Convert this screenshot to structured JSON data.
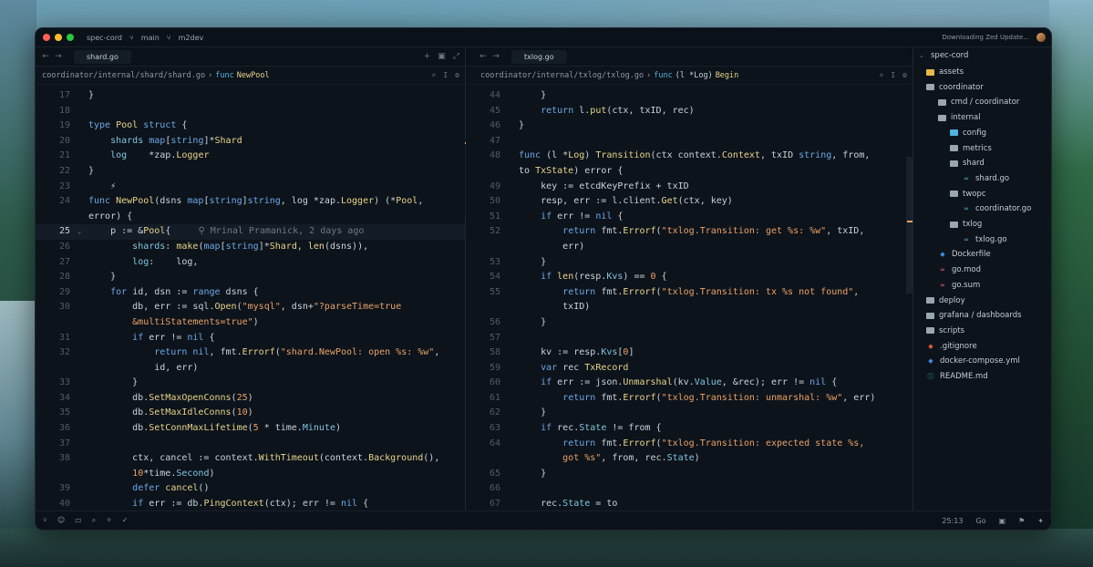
{
  "titlebar": {
    "project": "spec-cord",
    "branch_icon": "git-branch-icon",
    "branch": "main",
    "remote_icon": "remote-icon",
    "remote": "m2dev",
    "update_status": "Downloading Zed Update..."
  },
  "left_pane": {
    "tab": "shard.go",
    "breadcrumb_path": "coordinator/internal/shard/shard.go",
    "breadcrumb_sep": "›",
    "breadcrumb_kind": "func",
    "breadcrumb_symbol": "NewPool"
  },
  "right_pane": {
    "tab": "txlog.go",
    "breadcrumb_path": "coordinator/internal/txlog/txlog.go",
    "breadcrumb_sep": "›",
    "breadcrumb_kind": "func",
    "breadcrumb_symbol_prefix": "(l *Log)",
    "breadcrumb_symbol": "Begin"
  },
  "left_code": [
    {
      "n": "17",
      "segs": [
        [
          "v",
          "}"
        ]
      ]
    },
    {
      "n": "18",
      "segs": []
    },
    {
      "n": "19",
      "segs": [
        [
          "k",
          "type "
        ],
        [
          "t",
          "Pool "
        ],
        [
          "k",
          "struct "
        ],
        [
          "v",
          "{"
        ]
      ]
    },
    {
      "n": "20",
      "segs": [
        [
          "v",
          "    "
        ],
        [
          "p",
          "shards "
        ],
        [
          "k",
          "map"
        ],
        [
          "v",
          "["
        ],
        [
          "k",
          "string"
        ],
        [
          "v",
          "]*"
        ],
        [
          "t",
          "Shard"
        ]
      ]
    },
    {
      "n": "21",
      "segs": [
        [
          "v",
          "    "
        ],
        [
          "p",
          "log    "
        ],
        [
          "v",
          "*zap."
        ],
        [
          "t",
          "Logger"
        ]
      ]
    },
    {
      "n": "22",
      "segs": [
        [
          "v",
          "}"
        ]
      ]
    },
    {
      "n": "23",
      "segs": [
        [
          "v",
          "    ⚡"
        ]
      ]
    },
    {
      "n": "24",
      "segs": [
        [
          "k",
          "func "
        ],
        [
          "f",
          "NewPool"
        ],
        [
          "v",
          "(dsns "
        ],
        [
          "k",
          "map"
        ],
        [
          "v",
          "["
        ],
        [
          "k",
          "string"
        ],
        [
          "v",
          "]"
        ],
        [
          "k",
          "string"
        ],
        [
          "v",
          ", log *zap."
        ],
        [
          "t",
          "Logger"
        ],
        [
          "v",
          ") (*"
        ],
        [
          "t",
          "Pool"
        ],
        [
          "v",
          ","
        ]
      ]
    },
    {
      "n": "",
      "segs": [
        [
          "v",
          "error) {"
        ]
      ]
    },
    {
      "n": "25",
      "active": true,
      "segs": [
        [
          "v",
          "    p := &"
        ],
        [
          "t",
          "Pool"
        ],
        [
          "v",
          "{"
        ],
        [
          "c",
          "     ⚲ Mrinal Pramanick, 2 days ago"
        ]
      ]
    },
    {
      "n": "26",
      "segs": [
        [
          "v",
          "        "
        ],
        [
          "p",
          "shards"
        ],
        [
          "v",
          ": "
        ],
        [
          "f",
          "make"
        ],
        [
          "v",
          "("
        ],
        [
          "k",
          "map"
        ],
        [
          "v",
          "["
        ],
        [
          "k",
          "string"
        ],
        [
          "v",
          "]*"
        ],
        [
          "t",
          "Shard"
        ],
        [
          "v",
          ", "
        ],
        [
          "f",
          "len"
        ],
        [
          "v",
          "(dsns)),"
        ]
      ]
    },
    {
      "n": "27",
      "segs": [
        [
          "v",
          "        "
        ],
        [
          "p",
          "log"
        ],
        [
          "v",
          ":    log,"
        ]
      ]
    },
    {
      "n": "28",
      "segs": [
        [
          "v",
          "    }"
        ]
      ]
    },
    {
      "n": "29",
      "segs": [
        [
          "v",
          "    "
        ],
        [
          "k",
          "for "
        ],
        [
          "v",
          "id, dsn := "
        ],
        [
          "k",
          "range "
        ],
        [
          "v",
          "dsns {"
        ]
      ]
    },
    {
      "n": "30",
      "segs": [
        [
          "v",
          "        db, err := sql."
        ],
        [
          "f",
          "Open"
        ],
        [
          "v",
          "("
        ],
        [
          "s",
          "\"mysql\""
        ],
        [
          "v",
          ", dsn+"
        ],
        [
          "s",
          "\"?parseTime=true"
        ]
      ]
    },
    {
      "n": "",
      "segs": [
        [
          "s",
          "        &multiStatements=true\""
        ],
        [
          "v",
          ")"
        ]
      ]
    },
    {
      "n": "31",
      "segs": [
        [
          "v",
          "        "
        ],
        [
          "k",
          "if "
        ],
        [
          "v",
          "err != "
        ],
        [
          "k",
          "nil "
        ],
        [
          "v",
          "{"
        ]
      ]
    },
    {
      "n": "32",
      "segs": [
        [
          "v",
          "            "
        ],
        [
          "k",
          "return "
        ],
        [
          "k",
          "nil"
        ],
        [
          "v",
          ", fmt."
        ],
        [
          "f",
          "Errorf"
        ],
        [
          "v",
          "("
        ],
        [
          "s",
          "\"shard.NewPool: open %s: %w\""
        ],
        [
          "v",
          ","
        ]
      ]
    },
    {
      "n": "",
      "segs": [
        [
          "v",
          "            id, err)"
        ]
      ]
    },
    {
      "n": "33",
      "segs": [
        [
          "v",
          "        }"
        ]
      ]
    },
    {
      "n": "34",
      "segs": [
        [
          "v",
          "        db."
        ],
        [
          "f",
          "SetMaxOpenConns"
        ],
        [
          "v",
          "("
        ],
        [
          "n",
          "25"
        ],
        [
          "v",
          ")"
        ]
      ]
    },
    {
      "n": "35",
      "segs": [
        [
          "v",
          "        db."
        ],
        [
          "f",
          "SetMaxIdleConns"
        ],
        [
          "v",
          "("
        ],
        [
          "n",
          "10"
        ],
        [
          "v",
          ")"
        ]
      ]
    },
    {
      "n": "36",
      "segs": [
        [
          "v",
          "        db."
        ],
        [
          "f",
          "SetConnMaxLifetime"
        ],
        [
          "v",
          "("
        ],
        [
          "n",
          "5 "
        ],
        [
          "v",
          "* time."
        ],
        [
          "p",
          "Minute"
        ],
        [
          "v",
          ")"
        ]
      ]
    },
    {
      "n": "37",
      "segs": []
    },
    {
      "n": "38",
      "segs": [
        [
          "v",
          "        ctx, cancel := context."
        ],
        [
          "f",
          "WithTimeout"
        ],
        [
          "v",
          "(context."
        ],
        [
          "f",
          "Background"
        ],
        [
          "v",
          "(),"
        ]
      ]
    },
    {
      "n": "",
      "segs": [
        [
          "v",
          "        "
        ],
        [
          "n",
          "10"
        ],
        [
          "v",
          "*time."
        ],
        [
          "p",
          "Second"
        ],
        [
          "v",
          ")"
        ]
      ]
    },
    {
      "n": "39",
      "segs": [
        [
          "v",
          "        "
        ],
        [
          "k",
          "defer "
        ],
        [
          "f",
          "cancel"
        ],
        [
          "v",
          "()"
        ]
      ]
    },
    {
      "n": "40",
      "segs": [
        [
          "v",
          "        "
        ],
        [
          "k",
          "if "
        ],
        [
          "v",
          "err := db."
        ],
        [
          "f",
          "PingContext"
        ],
        [
          "v",
          "(ctx); err != "
        ],
        [
          "k",
          "nil "
        ],
        [
          "v",
          "{"
        ]
      ]
    }
  ],
  "right_code": [
    {
      "n": "44",
      "segs": [
        [
          "v",
          "    }"
        ]
      ]
    },
    {
      "n": "45",
      "segs": [
        [
          "v",
          "    "
        ],
        [
          "k",
          "return "
        ],
        [
          "v",
          "l."
        ],
        [
          "f",
          "put"
        ],
        [
          "v",
          "(ctx, txID, rec)"
        ]
      ]
    },
    {
      "n": "46",
      "segs": [
        [
          "v",
          "}"
        ]
      ]
    },
    {
      "n": "47",
      "segs": []
    },
    {
      "n": "48",
      "segs": [
        [
          "k",
          "func "
        ],
        [
          "v",
          "(l *"
        ],
        [
          "t",
          "Log"
        ],
        [
          "v",
          ") "
        ],
        [
          "f",
          "Transition"
        ],
        [
          "v",
          "(ctx context."
        ],
        [
          "t",
          "Context"
        ],
        [
          "v",
          ", txID "
        ],
        [
          "k",
          "string"
        ],
        [
          "v",
          ", from,"
        ]
      ]
    },
    {
      "n": "",
      "segs": [
        [
          "v",
          "to "
        ],
        [
          "t",
          "TxState"
        ],
        [
          "v",
          ") error {"
        ]
      ]
    },
    {
      "n": "49",
      "segs": [
        [
          "v",
          "    key := etcdKeyPrefix + txID"
        ]
      ]
    },
    {
      "n": "50",
      "segs": [
        [
          "v",
          "    resp, err := l.client."
        ],
        [
          "f",
          "Get"
        ],
        [
          "v",
          "(ctx, key)"
        ]
      ]
    },
    {
      "n": "51",
      "segs": [
        [
          "v",
          "    "
        ],
        [
          "k",
          "if "
        ],
        [
          "v",
          "err != "
        ],
        [
          "k",
          "nil "
        ],
        [
          "v",
          "{"
        ]
      ]
    },
    {
      "n": "52",
      "segs": [
        [
          "v",
          "        "
        ],
        [
          "k",
          "return "
        ],
        [
          "v",
          "fmt."
        ],
        [
          "f",
          "Errorf"
        ],
        [
          "v",
          "("
        ],
        [
          "s",
          "\"txlog.Transition: get %s: %w\""
        ],
        [
          "v",
          ", txID,"
        ]
      ]
    },
    {
      "n": "",
      "segs": [
        [
          "v",
          "        err)"
        ]
      ]
    },
    {
      "n": "53",
      "segs": [
        [
          "v",
          "    }"
        ]
      ]
    },
    {
      "n": "54",
      "segs": [
        [
          "v",
          "    "
        ],
        [
          "k",
          "if "
        ],
        [
          "f",
          "len"
        ],
        [
          "v",
          "(resp."
        ],
        [
          "p",
          "Kvs"
        ],
        [
          "v",
          ") == "
        ],
        [
          "n",
          "0 "
        ],
        [
          "v",
          "{"
        ]
      ]
    },
    {
      "n": "55",
      "segs": [
        [
          "v",
          "        "
        ],
        [
          "k",
          "return "
        ],
        [
          "v",
          "fmt."
        ],
        [
          "f",
          "Errorf"
        ],
        [
          "v",
          "("
        ],
        [
          "s",
          "\"txlog.Transition: tx %s not found\""
        ],
        [
          "v",
          ","
        ]
      ]
    },
    {
      "n": "",
      "segs": [
        [
          "v",
          "        txID)"
        ]
      ]
    },
    {
      "n": "56",
      "segs": [
        [
          "v",
          "    }"
        ]
      ]
    },
    {
      "n": "57",
      "segs": []
    },
    {
      "n": "58",
      "segs": [
        [
          "v",
          "    kv := resp."
        ],
        [
          "p",
          "Kvs"
        ],
        [
          "v",
          "["
        ],
        [
          "n",
          "0"
        ],
        [
          "v",
          "]"
        ]
      ]
    },
    {
      "n": "59",
      "segs": [
        [
          "v",
          "    "
        ],
        [
          "k",
          "var "
        ],
        [
          "v",
          "rec "
        ],
        [
          "t",
          "TxRecord"
        ]
      ]
    },
    {
      "n": "60",
      "segs": [
        [
          "v",
          "    "
        ],
        [
          "k",
          "if "
        ],
        [
          "v",
          "err := json."
        ],
        [
          "f",
          "Unmarshal"
        ],
        [
          "v",
          "(kv."
        ],
        [
          "p",
          "Value"
        ],
        [
          "v",
          ", &rec); err != "
        ],
        [
          "k",
          "nil "
        ],
        [
          "v",
          "{"
        ]
      ]
    },
    {
      "n": "61",
      "segs": [
        [
          "v",
          "        "
        ],
        [
          "k",
          "return "
        ],
        [
          "v",
          "fmt."
        ],
        [
          "f",
          "Errorf"
        ],
        [
          "v",
          "("
        ],
        [
          "s",
          "\"txlog.Transition: unmarshal: %w\""
        ],
        [
          "v",
          ", err)"
        ]
      ]
    },
    {
      "n": "62",
      "segs": [
        [
          "v",
          "    }"
        ]
      ]
    },
    {
      "n": "63",
      "segs": [
        [
          "v",
          "    "
        ],
        [
          "k",
          "if "
        ],
        [
          "v",
          "rec."
        ],
        [
          "p",
          "State "
        ],
        [
          "v",
          "!= from {"
        ]
      ]
    },
    {
      "n": "64",
      "segs": [
        [
          "v",
          "        "
        ],
        [
          "k",
          "return "
        ],
        [
          "v",
          "fmt."
        ],
        [
          "f",
          "Errorf"
        ],
        [
          "v",
          "("
        ],
        [
          "s",
          "\"txlog.Transition: expected state %s,"
        ]
      ]
    },
    {
      "n": "",
      "segs": [
        [
          "s",
          "        got %s\""
        ],
        [
          "v",
          ", from, rec."
        ],
        [
          "p",
          "State"
        ],
        [
          "v",
          ")"
        ]
      ]
    },
    {
      "n": "65",
      "segs": [
        [
          "v",
          "    }"
        ]
      ]
    },
    {
      "n": "66",
      "segs": []
    },
    {
      "n": "67",
      "segs": [
        [
          "v",
          "    rec."
        ],
        [
          "p",
          "State "
        ],
        [
          "v",
          "= to"
        ]
      ]
    }
  ],
  "sidebar": {
    "root": "spec-cord",
    "items": [
      {
        "label": "assets",
        "kind": "folder-yellow",
        "depth": 0
      },
      {
        "label": "coordinator",
        "kind": "folder",
        "depth": 0
      },
      {
        "label": "cmd / coordinator",
        "kind": "folder",
        "depth": 1
      },
      {
        "label": "internal",
        "kind": "folder",
        "depth": 1
      },
      {
        "label": "config",
        "kind": "folder-blue",
        "depth": 2
      },
      {
        "label": "metrics",
        "kind": "folder",
        "depth": 2
      },
      {
        "label": "shard",
        "kind": "folder",
        "depth": 2
      },
      {
        "label": "shard.go",
        "kind": "go",
        "depth": 3
      },
      {
        "label": "twopc",
        "kind": "folder",
        "depth": 2
      },
      {
        "label": "coordinator.go",
        "kind": "go",
        "depth": 3
      },
      {
        "label": "txlog",
        "kind": "folder",
        "depth": 2
      },
      {
        "label": "txlog.go",
        "kind": "go",
        "depth": 3
      },
      {
        "label": "Dockerfile",
        "kind": "docker",
        "depth": 1
      },
      {
        "label": "go.mod",
        "kind": "gomod",
        "depth": 1
      },
      {
        "label": "go.sum",
        "kind": "gomod",
        "depth": 1
      },
      {
        "label": "deploy",
        "kind": "folder",
        "depth": 0
      },
      {
        "label": "grafana / dashboards",
        "kind": "folder",
        "depth": 0
      },
      {
        "label": "scripts",
        "kind": "folder",
        "depth": 0
      },
      {
        "label": ".gitignore",
        "kind": "git",
        "depth": 0
      },
      {
        "label": "docker-compose.yml",
        "kind": "docker",
        "depth": 0
      },
      {
        "label": "README.md",
        "kind": "info",
        "depth": 0
      }
    ]
  },
  "statusbar": {
    "cursor": "25:13",
    "language": "Go"
  },
  "colors": {
    "keyword": "#6ba8e6",
    "type": "#e6d48a",
    "string": "#e8a268",
    "field": "#7ec6e0",
    "comment": "#6d7885"
  }
}
